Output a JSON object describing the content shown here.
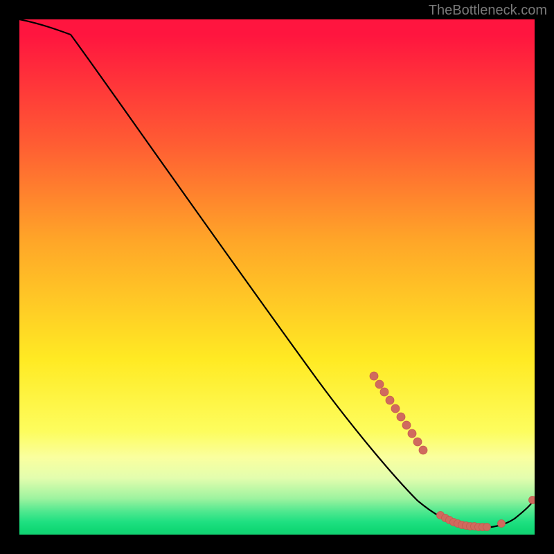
{
  "attribution": "TheBottleneck.com",
  "chart_data": {
    "type": "line",
    "title": "",
    "xlabel": "",
    "ylabel": "",
    "xlim": [
      0,
      100
    ],
    "ylim": [
      0,
      100
    ],
    "grid": false,
    "legend": false,
    "series": [
      {
        "name": "bottleneck-curve",
        "x": [
          0,
          5,
          10,
          20,
          30,
          40,
          50,
          60,
          65,
          70,
          73,
          76,
          79,
          82,
          85,
          88,
          91,
          94,
          97,
          100
        ],
        "values": [
          100,
          99,
          97,
          87,
          77,
          66,
          55,
          44,
          38,
          30,
          24,
          18,
          13,
          9,
          5,
          3,
          2,
          2,
          4,
          7
        ],
        "color": "#000000",
        "marker": "none"
      },
      {
        "name": "highlight-dots",
        "x": [
          69,
          70.5,
          72,
          73.5,
          75,
          76.5,
          78,
          82,
          82.8,
          83.6,
          84.4,
          85.2,
          86,
          86.8,
          87.6,
          88.4,
          89.2,
          90,
          90.8,
          94,
          99.7
        ],
        "values": [
          31,
          28.5,
          26,
          23.5,
          21,
          18.5,
          16,
          5.0,
          4.5,
          4.0,
          3.6,
          3.3,
          3.0,
          2.8,
          2.6,
          2.5,
          2.4,
          2.3,
          2.3,
          2.5,
          7
        ],
        "color": "#d06a5e",
        "marker": "circle"
      }
    ],
    "background": {
      "type": "vertical-gradient",
      "stops": [
        {
          "pos": 0.0,
          "color": "#ff153f"
        },
        {
          "pos": 0.24,
          "color": "#ff5c33"
        },
        {
          "pos": 0.43,
          "color": "#ffa628"
        },
        {
          "pos": 0.66,
          "color": "#ffea23"
        },
        {
          "pos": 0.85,
          "color": "#faff9f"
        },
        {
          "pos": 0.93,
          "color": "#9df39f"
        },
        {
          "pos": 1.0,
          "color": "#12d172"
        }
      ]
    }
  }
}
